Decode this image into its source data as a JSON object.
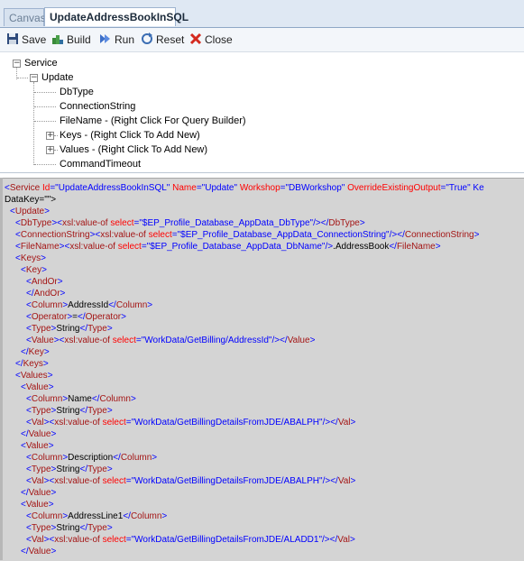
{
  "tabs": [
    {
      "label": "Canvas",
      "active": false
    },
    {
      "label": "UpdateAddressBookInSQL",
      "active": true
    }
  ],
  "toolbar": {
    "save": "Save",
    "build": "Build",
    "run": "Run",
    "reset": "Reset",
    "close": "Close"
  },
  "tree": {
    "service": "Service",
    "update": "Update",
    "children": [
      "DbType",
      "ConnectionString",
      "FileName - (Right Click For Query Builder)",
      "Keys - (Right Click To Add New)",
      "Values - (Right Click To Add New)",
      "CommandTimeout"
    ]
  },
  "xml": {
    "service_open_1": "<Service Id=\"UpdateAddressBookInSQL\" Name=\"Update\" Workshop=\"DBWorkshop\" OverrideExistingOutput=\"True\" Ke",
    "service_open_2": "DataKey=\"\">",
    "lines": [
      "<Update>",
      "<DbType><xsl:value-of select=\"$EP_Profile_Database_AppData_DbType\"/></DbType>",
      "<ConnectionString><xsl:value-of select=\"$EP_Profile_Database_AppData_ConnectionString\"/></ConnectionString>",
      "<FileName><xsl:value-of select=\"$EP_Profile_Database_AppData_DbName\"/>.AddressBook</FileName>",
      "<Keys>",
      "<Key>",
      "<AndOr>",
      "</AndOr>",
      "<Column>AddressId</Column>",
      "<Operator>=</Operator>",
      "<Type>String</Type>",
      "<Value><xsl:value-of select=\"WorkData/GetBilling/AddressId\"/></Value>",
      "</Key>",
      "</Keys>",
      "<Values>",
      "<Value>",
      "<Column>Name</Column>",
      "<Type>String</Type>",
      "<Val><xsl:value-of select=\"WorkData/GetBillingDetailsFromJDE/ABALPH\"/></Val>",
      "</Value>",
      "<Value>",
      "<Column>Description</Column>",
      "<Type>String</Type>",
      "<Val><xsl:value-of select=\"WorkData/GetBillingDetailsFromJDE/ABALPH\"/></Val>",
      "</Value>",
      "<Value>",
      "<Column>AddressLine1</Column>",
      "<Type>String</Type>",
      "<Val><xsl:value-of select=\"WorkData/GetBillingDetailsFromJDE/ALADD1\"/></Val>",
      "</Value>"
    ]
  },
  "colors": {
    "tag": "#a31515",
    "attribute": "#ff0000",
    "value": "#0000ff",
    "pane_bg": "#d4d4d4"
  }
}
